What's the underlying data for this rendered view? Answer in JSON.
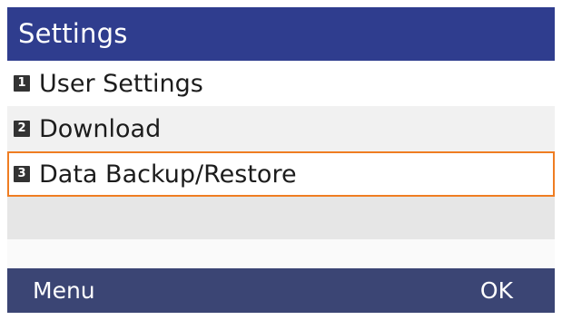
{
  "title": "Settings",
  "menu": {
    "items": [
      {
        "number": "1",
        "label": "User Settings",
        "selected": false
      },
      {
        "number": "2",
        "label": "Download",
        "selected": false
      },
      {
        "number": "3",
        "label": "Data Backup/Restore",
        "selected": true
      }
    ]
  },
  "softkeys": {
    "left": "Menu",
    "right": "OK"
  },
  "colors": {
    "title_bar": "#2f3d8e",
    "softkey_bar": "#3b4574",
    "selection_border": "#ef7d22"
  }
}
